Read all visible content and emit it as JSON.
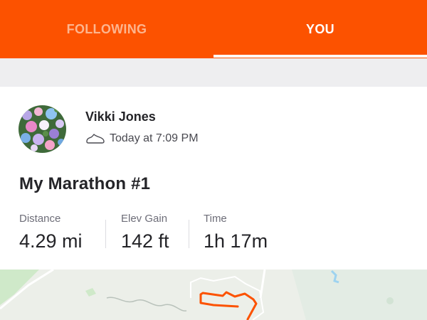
{
  "tabs": {
    "following_label": "FOLLOWING",
    "you_label": "YOU",
    "active": "YOU"
  },
  "activity": {
    "athlete_name": "Vikki Jones",
    "time_text": "Today at 7:09 PM",
    "sport_icon": "shoe-icon",
    "title": "My Marathon #1",
    "stats": {
      "distance_label": "Distance",
      "distance_value": "4.29 mi",
      "elev_label": "Elev Gain",
      "elev_value": "142 ft",
      "time_label": "Time",
      "time_value": "1h 17m"
    }
  },
  "colors": {
    "brand": "#fc5200",
    "route": "#fc5200",
    "map_background": "#ecefe9",
    "map_green": "#cfe9c9",
    "water": "#9ed3f0"
  }
}
